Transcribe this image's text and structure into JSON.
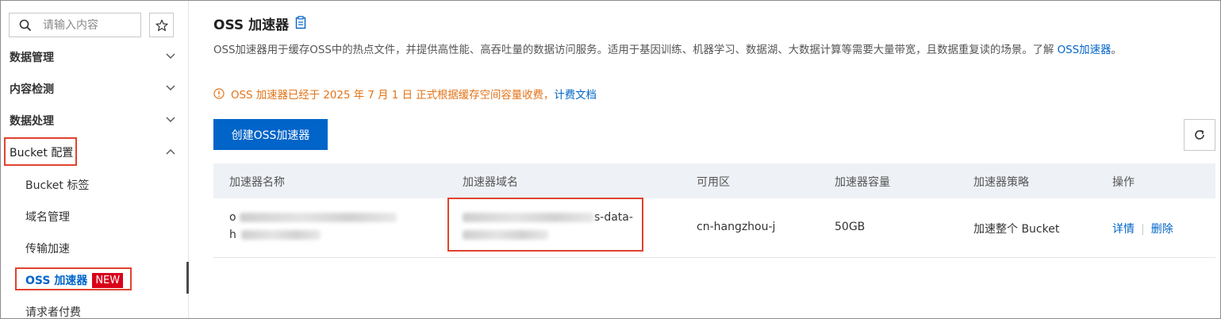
{
  "sidebar": {
    "search_placeholder": "请输入内容",
    "groups": [
      {
        "label": "数据管理"
      },
      {
        "label": "内容检测"
      },
      {
        "label": "数据处理"
      },
      {
        "label": "Bucket 配置"
      }
    ],
    "sub_items": [
      {
        "label": "Bucket 标签"
      },
      {
        "label": "域名管理"
      },
      {
        "label": "传输加速"
      },
      {
        "label": "OSS 加速器",
        "badge": "NEW"
      },
      {
        "label": "请求者付费"
      }
    ]
  },
  "main": {
    "title": "OSS 加速器",
    "description": "OSS加速器用于缓存OSS中的热点文件，并提供高性能、高吞吐量的数据访问服务。适用于基因训练、机器学习、数据湖、大数据计算等需要大量带宽，且数据重复读的场景。了解 ",
    "description_link": "OSS加速器",
    "description_end": "。",
    "notice": "OSS 加速器已经于 2025 年 7 月 1 日 正式根据缓存空间容量收费，",
    "notice_link": "计费文档",
    "create_button": "创建OSS加速器",
    "table": {
      "headers": [
        "加速器名称",
        "加速器域名",
        "可用区",
        "加速器容量",
        "加速器策略",
        "操作"
      ],
      "rows": [
        {
          "name_prefix_1": "o",
          "name_prefix_2": "h",
          "domain_suffix": "s-data-",
          "zone": "cn-hangzhou-j",
          "capacity": "50GB",
          "policy": "加速整个 Bucket",
          "action_detail": "详情",
          "action_delete": "删除"
        }
      ]
    }
  },
  "colors": {
    "accent": "#0064c8",
    "warning": "#e37318",
    "highlight_box": "#e0432f",
    "badge": "#d9001b"
  }
}
